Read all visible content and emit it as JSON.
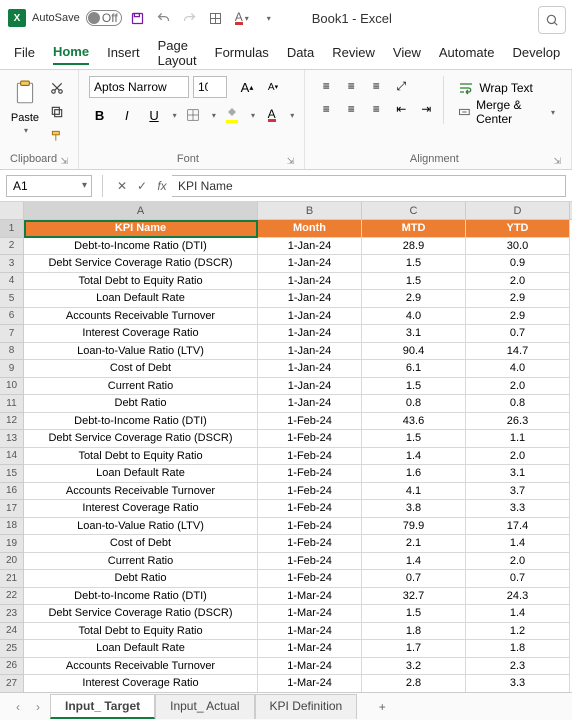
{
  "title": {
    "autosave": "AutoSave",
    "off": "Off",
    "book": "Book1 - Excel"
  },
  "tabs": [
    "File",
    "Home",
    "Insert",
    "Page Layout",
    "Formulas",
    "Data",
    "Review",
    "View",
    "Automate",
    "Develop"
  ],
  "active_tab": 1,
  "ribbon": {
    "clipboard": {
      "paste": "Paste",
      "label": "Clipboard"
    },
    "font": {
      "name": "Aptos Narrow",
      "size": "10",
      "B": "B",
      "I": "I",
      "U": "U",
      "label": "Font"
    },
    "alignment": {
      "wrap": "Wrap Text",
      "merge": "Merge & Center",
      "label": "Alignment"
    }
  },
  "fx": {
    "ref": "A1",
    "value": "KPI Name"
  },
  "columns": [
    "A",
    "B",
    "C",
    "D"
  ],
  "headers": [
    "KPI Name",
    "Month",
    "MTD",
    "YTD"
  ],
  "rows": [
    {
      "a": "Debt-to-Income Ratio (DTI)",
      "b": "1-Jan-24",
      "c": "28.9",
      "d": "30.0"
    },
    {
      "a": "Debt Service Coverage Ratio (DSCR)",
      "b": "1-Jan-24",
      "c": "1.5",
      "d": "0.9"
    },
    {
      "a": "Total Debt to Equity Ratio",
      "b": "1-Jan-24",
      "c": "1.5",
      "d": "2.0"
    },
    {
      "a": "Loan Default Rate",
      "b": "1-Jan-24",
      "c": "2.9",
      "d": "2.9"
    },
    {
      "a": "Accounts Receivable Turnover",
      "b": "1-Jan-24",
      "c": "4.0",
      "d": "2.9"
    },
    {
      "a": "Interest Coverage Ratio",
      "b": "1-Jan-24",
      "c": "3.1",
      "d": "0.7"
    },
    {
      "a": "Loan-to-Value Ratio (LTV)",
      "b": "1-Jan-24",
      "c": "90.4",
      "d": "14.7"
    },
    {
      "a": "Cost of Debt",
      "b": "1-Jan-24",
      "c": "6.1",
      "d": "4.0"
    },
    {
      "a": "Current Ratio",
      "b": "1-Jan-24",
      "c": "1.5",
      "d": "2.0"
    },
    {
      "a": "Debt Ratio",
      "b": "1-Jan-24",
      "c": "0.8",
      "d": "0.8"
    },
    {
      "a": "Debt-to-Income Ratio (DTI)",
      "b": "1-Feb-24",
      "c": "43.6",
      "d": "26.3"
    },
    {
      "a": "Debt Service Coverage Ratio (DSCR)",
      "b": "1-Feb-24",
      "c": "1.5",
      "d": "1.1"
    },
    {
      "a": "Total Debt to Equity Ratio",
      "b": "1-Feb-24",
      "c": "1.4",
      "d": "2.0"
    },
    {
      "a": "Loan Default Rate",
      "b": "1-Feb-24",
      "c": "1.6",
      "d": "3.1"
    },
    {
      "a": "Accounts Receivable Turnover",
      "b": "1-Feb-24",
      "c": "4.1",
      "d": "3.7"
    },
    {
      "a": "Interest Coverage Ratio",
      "b": "1-Feb-24",
      "c": "3.8",
      "d": "3.3"
    },
    {
      "a": "Loan-to-Value Ratio (LTV)",
      "b": "1-Feb-24",
      "c": "79.9",
      "d": "17.4"
    },
    {
      "a": "Cost of Debt",
      "b": "1-Feb-24",
      "c": "2.1",
      "d": "1.4"
    },
    {
      "a": "Current Ratio",
      "b": "1-Feb-24",
      "c": "1.4",
      "d": "2.0"
    },
    {
      "a": "Debt Ratio",
      "b": "1-Feb-24",
      "c": "0.7",
      "d": "0.7"
    },
    {
      "a": "Debt-to-Income Ratio (DTI)",
      "b": "1-Mar-24",
      "c": "32.7",
      "d": "24.3"
    },
    {
      "a": "Debt Service Coverage Ratio (DSCR)",
      "b": "1-Mar-24",
      "c": "1.5",
      "d": "1.4"
    },
    {
      "a": "Total Debt to Equity Ratio",
      "b": "1-Mar-24",
      "c": "1.8",
      "d": "1.2"
    },
    {
      "a": "Loan Default Rate",
      "b": "1-Mar-24",
      "c": "1.7",
      "d": "1.8"
    },
    {
      "a": "Accounts Receivable Turnover",
      "b": "1-Mar-24",
      "c": "3.2",
      "d": "2.3"
    },
    {
      "a": "Interest Coverage Ratio",
      "b": "1-Mar-24",
      "c": "2.8",
      "d": "3.3"
    }
  ],
  "sheets": [
    "Input_ Target",
    "Input_ Actual",
    "KPI Definition"
  ],
  "active_sheet": 0
}
